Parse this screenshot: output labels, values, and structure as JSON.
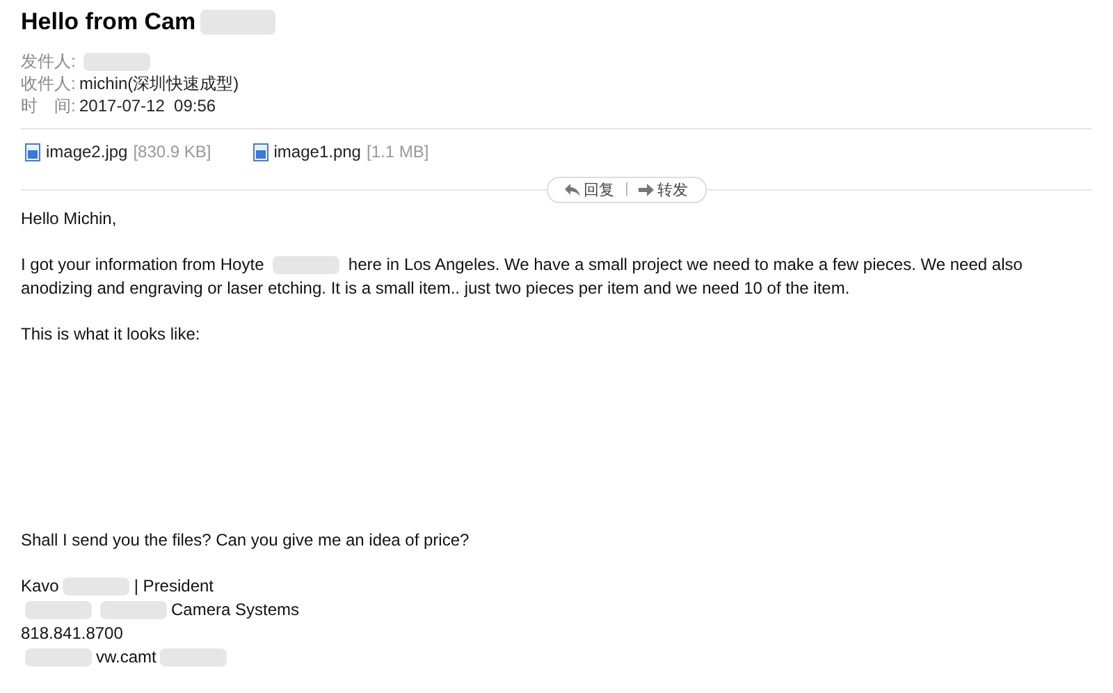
{
  "subject": [
    {
      "kind": "text",
      "text": "Hello from Cam"
    },
    {
      "kind": "redacted"
    }
  ],
  "meta": [
    {
      "label": "发件人:",
      "parts": [
        {
          "kind": "redacted"
        }
      ]
    },
    {
      "label": "收件人:",
      "parts": [
        {
          "kind": "text",
          "text": "michin(深圳快速成型)"
        }
      ]
    },
    {
      "label": "时　间:",
      "parts": [
        {
          "kind": "text",
          "text": "2017-07-12  09:56"
        }
      ]
    }
  ],
  "attachments": [
    {
      "name": "image2.jpg",
      "size": "[830.9 KB]"
    },
    {
      "name": "image1.png",
      "size": "[1.1 MB]"
    }
  ],
  "actions": [
    {
      "label": "回复",
      "kind": "reply"
    },
    {
      "label": "转发",
      "kind": "forward"
    }
  ],
  "body": [
    {
      "kind": "para",
      "parts": [
        {
          "kind": "text",
          "text": "Hello Michin,"
        }
      ]
    },
    {
      "kind": "para",
      "parts": [
        {
          "kind": "text",
          "text": "I got your information from Hoyte "
        },
        {
          "kind": "redacted"
        },
        {
          "kind": "text",
          "text": " here in Los Angeles. We have a small project we need to make a few pieces. We need also anodizing and engraving or laser etching. It is a small item.. just two pieces per item and we need 10 of the item."
        }
      ]
    },
    {
      "kind": "para",
      "parts": [
        {
          "kind": "text",
          "text": "This is what it looks like:"
        }
      ]
    },
    {
      "kind": "image-gap"
    },
    {
      "kind": "para",
      "parts": [
        {
          "kind": "text",
          "text": "Shall I send you the files? Can you give me an idea of price?"
        }
      ]
    },
    {
      "kind": "signature",
      "lines": [
        [
          {
            "kind": "text",
            "text": "Kavo"
          },
          {
            "kind": "redacted"
          },
          {
            "kind": "text",
            "text": "| President"
          }
        ],
        [
          {
            "kind": "redacted"
          },
          {
            "kind": "redacted"
          },
          {
            "kind": "text",
            "text": "Camera Systems"
          }
        ],
        [
          {
            "kind": "text",
            "text": "818.841.8700"
          }
        ],
        [
          {
            "kind": "redacted"
          },
          {
            "kind": "text",
            "text": "vw.camt"
          },
          {
            "kind": "redacted"
          }
        ]
      ]
    }
  ]
}
